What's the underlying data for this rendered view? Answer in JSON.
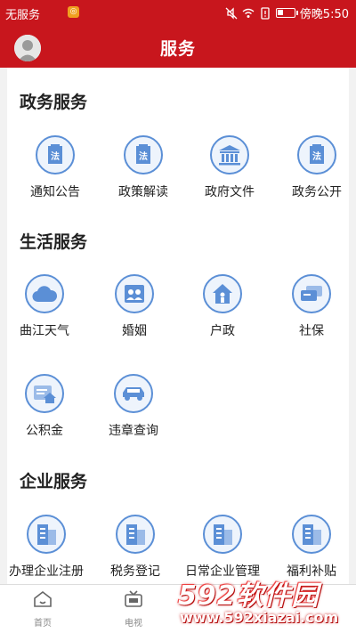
{
  "status_bar": {
    "carrier": "无服务",
    "time": "傍晚5:50"
  },
  "header": {
    "title": "服务"
  },
  "sections": [
    {
      "title": "政务服务",
      "items": [
        {
          "label": "通知公告",
          "icon": "law-book-icon"
        },
        {
          "label": "政策解读",
          "icon": "law-book-icon"
        },
        {
          "label": "政府文件",
          "icon": "government-building-icon"
        },
        {
          "label": "政务公开",
          "icon": "law-book-icon"
        }
      ]
    },
    {
      "title": "生活服务",
      "items": [
        {
          "label": "曲江天气",
          "icon": "cloud-icon"
        },
        {
          "label": "婚姻",
          "icon": "couple-photo-icon"
        },
        {
          "label": "户政",
          "icon": "household-icon"
        },
        {
          "label": "社保",
          "icon": "social-security-card-icon"
        },
        {
          "label": "公积金",
          "icon": "housing-fund-icon"
        },
        {
          "label": "违章查询",
          "icon": "car-icon"
        }
      ]
    },
    {
      "title": "企业服务",
      "items": [
        {
          "label": "办理企业注册",
          "icon": "office-building-icon"
        },
        {
          "label": "税务登记",
          "icon": "office-building-icon"
        },
        {
          "label": "日常企业管理",
          "icon": "office-building-icon"
        },
        {
          "label": "福利补贴",
          "icon": "office-building-icon"
        }
      ]
    }
  ],
  "bottom_nav": [
    {
      "label": "首页",
      "icon": "home-icon"
    },
    {
      "label": "电视",
      "icon": "tv-icon"
    }
  ],
  "watermark": {
    "logo_text": "592软件园",
    "url": "www.592xiazai.com"
  },
  "colors": {
    "brand_red": "#c8161d",
    "icon_blue": "#5b8fd6"
  }
}
